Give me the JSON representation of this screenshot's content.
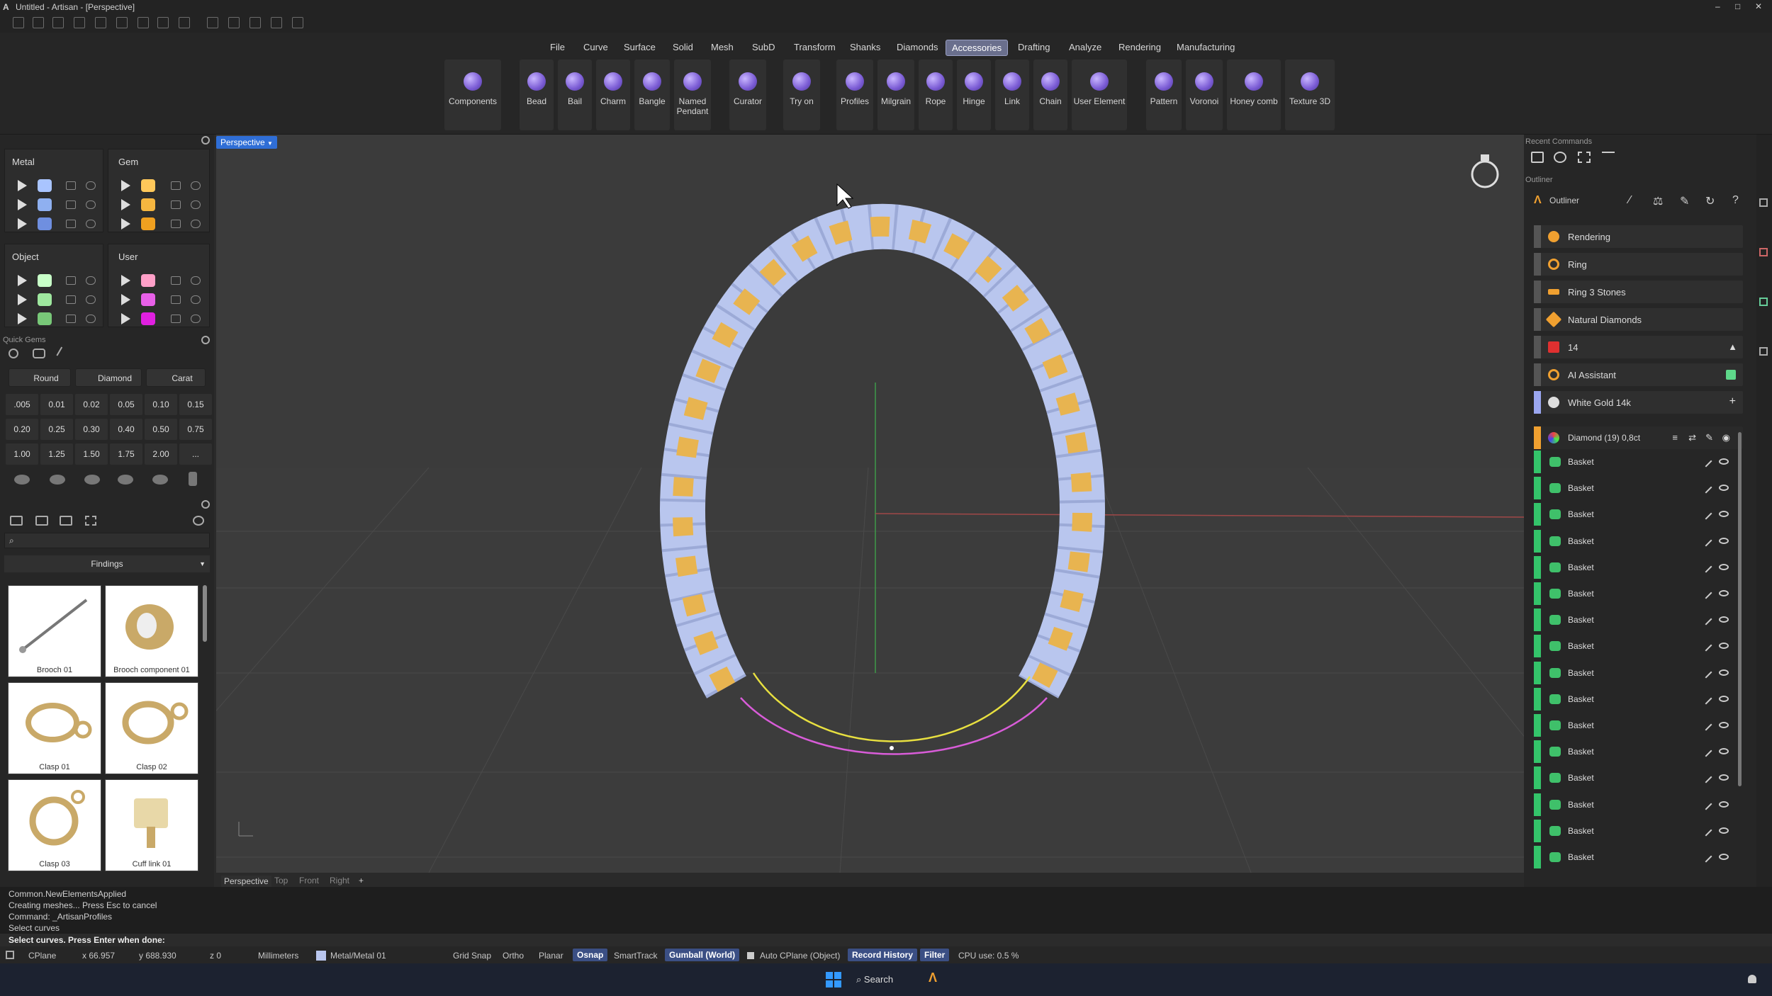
{
  "window": {
    "title": "Untitled - Artisan - [Perspective]"
  },
  "menu": [
    "File",
    "Curve",
    "Surface",
    "Solid",
    "Mesh",
    "SubD",
    "Transform",
    "Shanks",
    "Diamonds",
    "Accessories",
    "Drafting",
    "Analyze",
    "Rendering",
    "Manufacturing"
  ],
  "menu_active": "Accessories",
  "ribbon": [
    {
      "label": "Components"
    },
    {
      "label": "Bead"
    },
    {
      "label": "Bail"
    },
    {
      "label": "Charm"
    },
    {
      "label": "Bangle"
    },
    {
      "label": "Named\nPendant"
    },
    {
      "label": "Curator"
    },
    {
      "label": "Try on"
    },
    {
      "label": "Profiles"
    },
    {
      "label": "Milgrain"
    },
    {
      "label": "Rope"
    },
    {
      "label": "Hinge"
    },
    {
      "label": "Link"
    },
    {
      "label": "Chain"
    },
    {
      "label": "User Element"
    },
    {
      "label": "Pattern"
    },
    {
      "label": "Voronoi"
    },
    {
      "label": "Honey comb"
    },
    {
      "label": "Texture 3D"
    }
  ],
  "layers": {
    "metal": {
      "title": "Metal",
      "colors": [
        "#a9c4ff",
        "#8fb0f0",
        "#6f8fe0"
      ]
    },
    "gem": {
      "title": "Gem",
      "colors": [
        "#ffc85a",
        "#f5b640",
        "#f0a020"
      ]
    },
    "object": {
      "title": "Object",
      "colors": [
        "#c8ffc8",
        "#9fe89f",
        "#78c878"
      ]
    },
    "user": {
      "title": "User",
      "colors": [
        "#ffa0c8",
        "#e860e8",
        "#e020e0"
      ]
    }
  },
  "quick_gems": {
    "title": "Quick Gems",
    "shape": "Round",
    "material": "Diamond",
    "unit": "Carat",
    "sizes": [
      ".005",
      "0.01",
      "0.02",
      "0.05",
      "0.10",
      "0.15",
      "0.20",
      "0.25",
      "0.30",
      "0.40",
      "0.50",
      "0.75",
      "1.00",
      "1.25",
      "1.50",
      "1.75",
      "2.00",
      "..."
    ]
  },
  "library": {
    "category": "Findings",
    "items": [
      "Brooch 01",
      "Brooch component 01",
      "Clasp 01",
      "Clasp 02",
      "Clasp 03",
      "Cuff link 01"
    ]
  },
  "viewport": {
    "name": "Perspective",
    "tabs": [
      "Perspective",
      "Top",
      "Front",
      "Right"
    ],
    "add": "+"
  },
  "right": {
    "recent": "Recent Commands",
    "outliner_label": "Outliner",
    "outliner_title": "Outliner",
    "items": [
      {
        "label": "Rendering",
        "color": "#f0a030"
      },
      {
        "label": "Ring",
        "color": "#f0a030"
      },
      {
        "label": "Ring 3 Stones",
        "color": "#f0a030"
      },
      {
        "label": "Natural Diamonds",
        "color": "#f0a030"
      },
      {
        "label": "14",
        "color": "#e03030"
      },
      {
        "label": "AI Assistant",
        "color": "#f0a030"
      },
      {
        "label": "White Gold 14k",
        "color": "#dddddd"
      }
    ],
    "group": "Diamond (19) 0,8ct",
    "rows": [
      "Basket",
      "Basket",
      "Basket",
      "Basket",
      "Basket",
      "Basket",
      "Basket",
      "Basket",
      "Basket",
      "Basket",
      "Basket",
      "Basket",
      "Basket",
      "Basket",
      "Basket",
      "Basket"
    ]
  },
  "command_history": [
    "Common.NewElementsApplied",
    "Creating meshes... Press Esc to cancel",
    "Command: _ArtisanProfiles",
    "Select curves"
  ],
  "prompt": "Select curves. Press Enter when done:",
  "status": {
    "cplane": "CPlane",
    "x": "x 66.957",
    "y": "y 688.930",
    "z": "z 0",
    "units": "Millimeters",
    "layer": "Metal/Metal 01",
    "grid": "Grid Snap",
    "ortho": "Ortho",
    "planar": "Planar",
    "osnap": "Osnap",
    "smarttrack": "SmartTrack",
    "gumball": "Gumball (World)",
    "autocplane": "Auto CPlane (Object)",
    "history": "Record History",
    "filter": "Filter",
    "cpu": "CPU use: 0.5 %"
  },
  "taskbar": {
    "search": "Search"
  }
}
